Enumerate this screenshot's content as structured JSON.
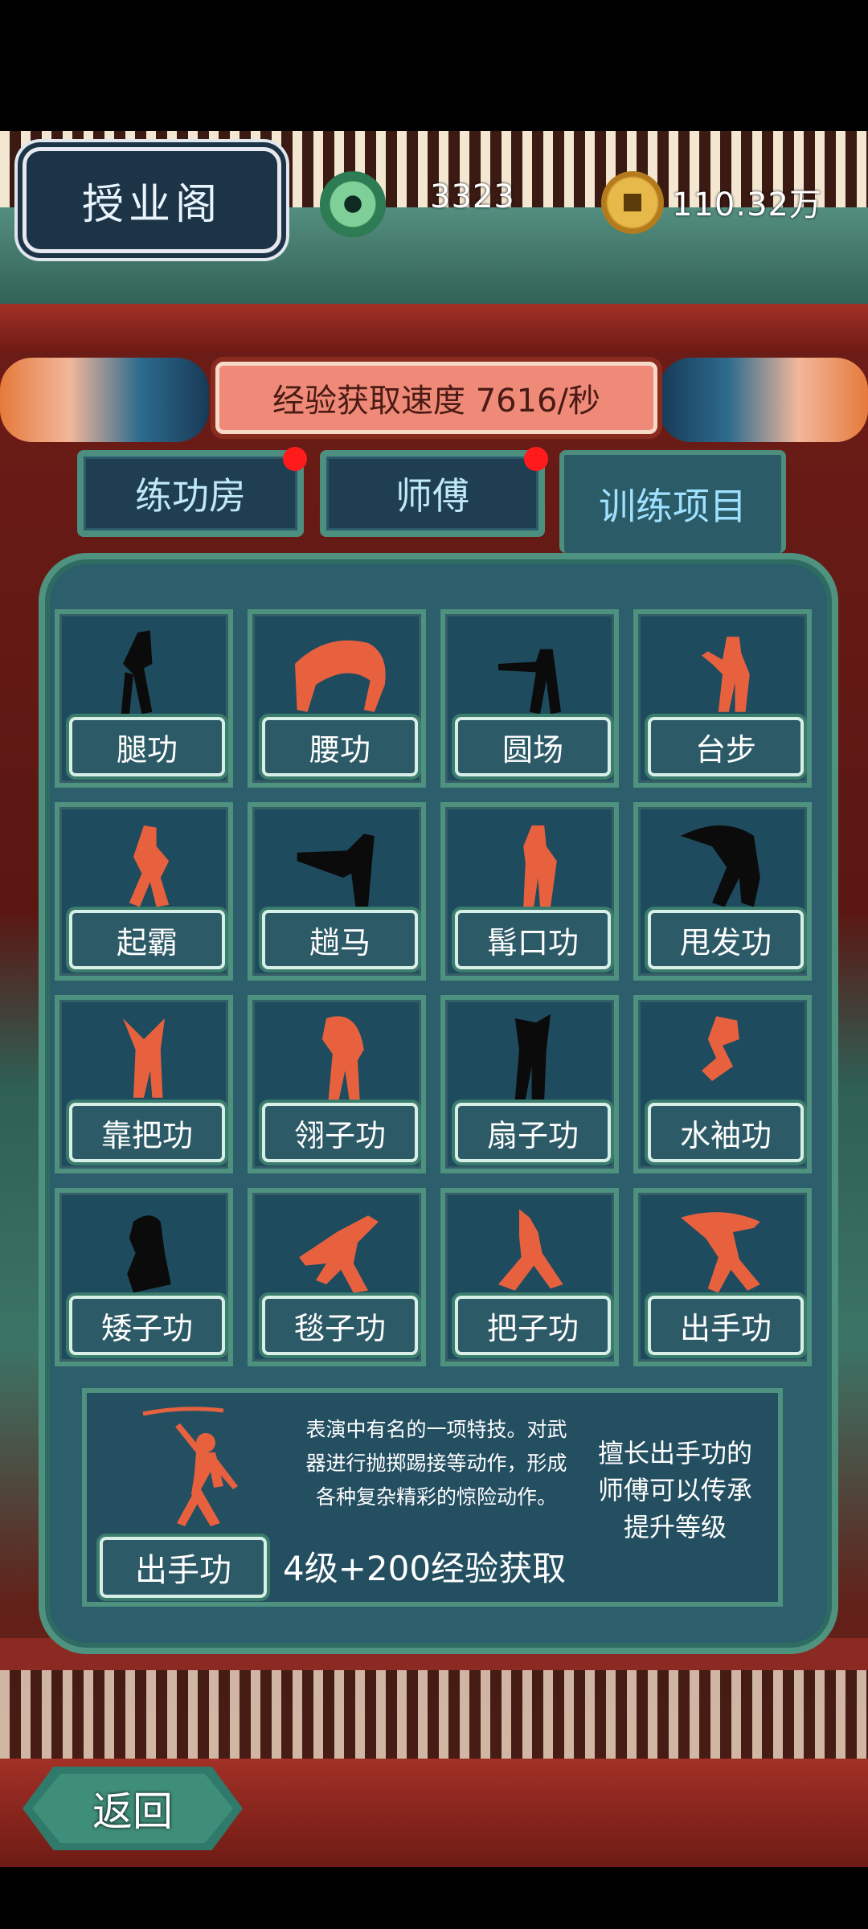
{
  "header": {
    "title": "授业阁",
    "jade_amount": "3323",
    "gold_amount": "110.32万"
  },
  "exp_banner": "经验获取速度 7616/秒",
  "tabs": [
    {
      "label": "练功房",
      "active": false,
      "badge": true
    },
    {
      "label": "师傅",
      "active": false,
      "badge": true
    },
    {
      "label": "训练项目",
      "active": true,
      "badge": false
    }
  ],
  "skills": [
    {
      "label": "腿功",
      "unlocked": false
    },
    {
      "label": "腰功",
      "unlocked": true
    },
    {
      "label": "圆场",
      "unlocked": false
    },
    {
      "label": "台步",
      "unlocked": true
    },
    {
      "label": "起霸",
      "unlocked": true
    },
    {
      "label": "趟马",
      "unlocked": false
    },
    {
      "label": "髯口功",
      "unlocked": true
    },
    {
      "label": "甩发功",
      "unlocked": false
    },
    {
      "label": "靠把功",
      "unlocked": true
    },
    {
      "label": "翎子功",
      "unlocked": true
    },
    {
      "label": "扇子功",
      "unlocked": false
    },
    {
      "label": "水袖功",
      "unlocked": true
    },
    {
      "label": "矮子功",
      "unlocked": false
    },
    {
      "label": "毯子功",
      "unlocked": true
    },
    {
      "label": "把子功",
      "unlocked": true
    },
    {
      "label": "出手功",
      "unlocked": true
    }
  ],
  "detail": {
    "name": "出手功",
    "description_lines": [
      "表演中有名的一项特技。对武",
      "器进行抛掷踢接等动作，形成",
      "各种复杂精彩的惊险动作。"
    ],
    "requirement": "4级+200经验获取",
    "hint_lines": [
      "擅长出手功的",
      "师傅可以传承",
      "提升等级"
    ]
  },
  "back_label": "返回",
  "colors": {
    "unlocked_figure": "#e8613f",
    "locked_figure": "#0b0b0b",
    "badge": "#ff1b1b"
  }
}
